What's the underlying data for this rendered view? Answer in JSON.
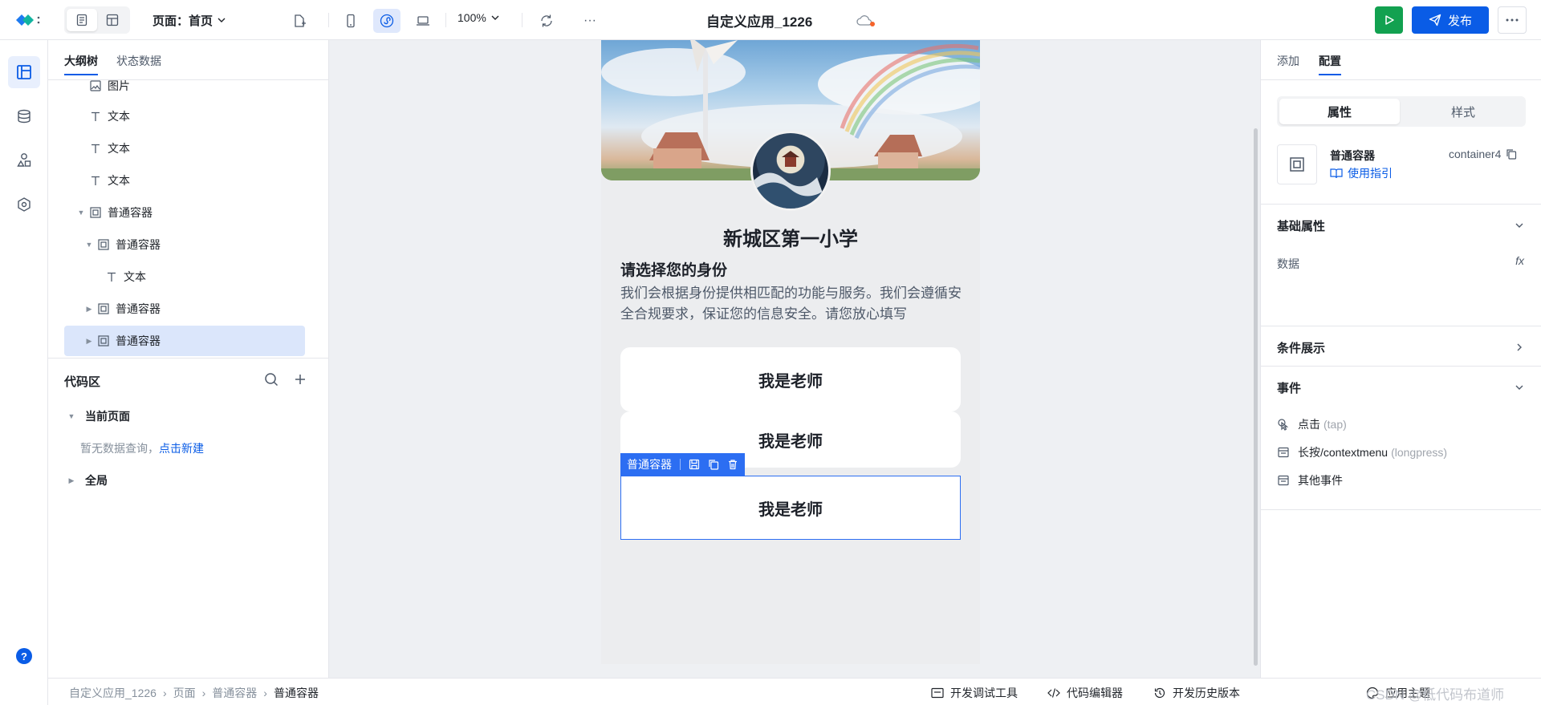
{
  "header": {
    "page_select_label": "页面：首页",
    "zoom": "100%",
    "app_title": "自定义应用_1226",
    "publish_label": "发布",
    "more_label": "···"
  },
  "left_panel": {
    "tabs": [
      "大纲树",
      "状态数据"
    ],
    "tree": [
      {
        "label": "图片",
        "icon": "image-icon"
      },
      {
        "label": "文本",
        "icon": "text-icon"
      },
      {
        "label": "文本",
        "icon": "text-icon"
      },
      {
        "label": "文本",
        "icon": "text-icon"
      },
      {
        "label": "普通容器",
        "icon": "container-icon"
      },
      {
        "label": "普通容器",
        "icon": "container-icon"
      },
      {
        "label": "文本",
        "icon": "text-icon"
      },
      {
        "label": "普通容器",
        "icon": "container-icon"
      },
      {
        "label": "普通容器",
        "icon": "container-icon"
      }
    ],
    "code_area": {
      "title": "代码区",
      "current_page": "当前页面",
      "empty_text": "暂无数据查询，",
      "create_link": "点击新建",
      "global": "全局"
    }
  },
  "canvas": {
    "school_name": "新城区第一小学",
    "choose_title": "请选择您的身份",
    "choose_desc": "我们会根据身份提供相匹配的功能与服务。我们会遵循安全合规要求，保证您的信息安全。请您放心填写",
    "cards": [
      "我是老师",
      "我是老师",
      "我是老师"
    ],
    "selection_label": "普通容器"
  },
  "right_panel": {
    "tabs": [
      "添加",
      "配置"
    ],
    "segment": [
      "属性",
      "样式"
    ],
    "component_name": "普通容器",
    "component_id": "container4",
    "guide_link": "使用指引",
    "basic_props": "基础属性",
    "data_label": "数据",
    "fx_label": "fx",
    "conditional": "条件展示",
    "events": "事件",
    "event_rows": [
      {
        "label": "点击",
        "sub": "(tap)"
      },
      {
        "label": "长按/contextmenu",
        "sub": "(longpress)"
      },
      {
        "label": "其他事件",
        "sub": ""
      }
    ]
  },
  "statusbar": {
    "breadcrumb": [
      "自定义应用_1226",
      "页面",
      "普通容器",
      "普通容器"
    ],
    "tools": [
      "开发调试工具",
      "代码编辑器",
      "开发历史版本"
    ],
    "right_text": "应用主题",
    "watermark": "CSDN @低代码布道师"
  },
  "colors": {
    "accent": "#0a5ce6",
    "run": "#12a150",
    "selected_row": "#dbe6fb",
    "canvas_bg": "#eef0f3"
  }
}
